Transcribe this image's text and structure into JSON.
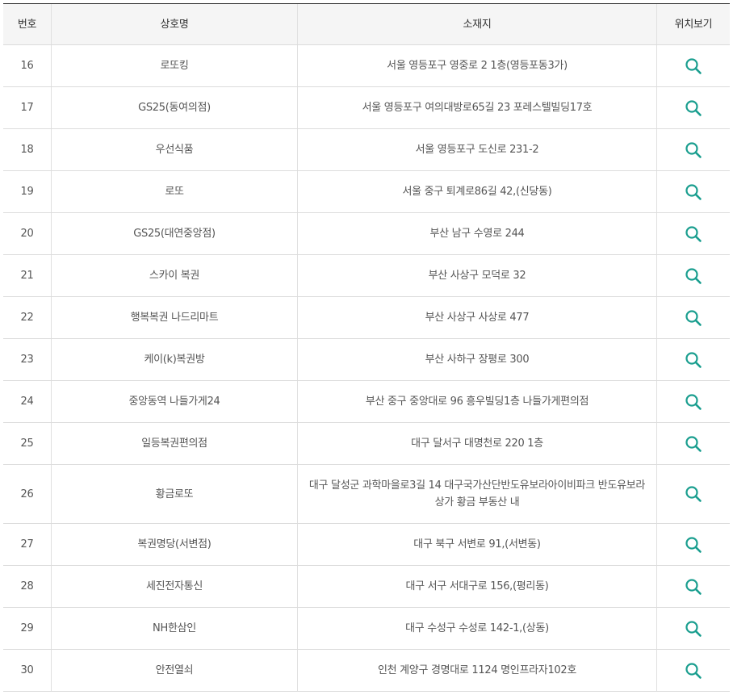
{
  "table": {
    "headers": {
      "number": "번호",
      "store_name": "상호명",
      "address": "소재지",
      "location": "위치보기"
    },
    "rows": [
      {
        "no": "16",
        "name": "로또킹",
        "address": "서울 영등포구 영중로 2 1층(영등포동3가)"
      },
      {
        "no": "17",
        "name": "GS25(동여의점)",
        "address": "서울 영등포구 여의대방로65길 23 포레스텔빌딩17호"
      },
      {
        "no": "18",
        "name": "우선식품",
        "address": "서울 영등포구 도신로 231-2"
      },
      {
        "no": "19",
        "name": "로또",
        "address": "서울 중구 퇴계로86길 42,(신당동)"
      },
      {
        "no": "20",
        "name": "GS25(대연중앙점)",
        "address": "부산 남구 수영로 244"
      },
      {
        "no": "21",
        "name": "스카이 복권",
        "address": "부산 사상구 모덕로 32"
      },
      {
        "no": "22",
        "name": "행복복권 나드리마트",
        "address": "부산 사상구 사상로 477"
      },
      {
        "no": "23",
        "name": "케이(k)복권방",
        "address": "부산 사하구 장평로 300"
      },
      {
        "no": "24",
        "name": "중앙동역 나들가게24",
        "address": "부산 중구 중앙대로 96 흥우빌딩1층 나들가게편의점"
      },
      {
        "no": "25",
        "name": "일등복권편의점",
        "address": "대구 달서구 대명천로 220 1층"
      },
      {
        "no": "26",
        "name": "황금로또",
        "address": "대구 달성군 과학마을로3길 14 대구국가산단반도유보라아이비파크 반도유보라 상가 황금 부동산 내"
      },
      {
        "no": "27",
        "name": "복권명당(서변점)",
        "address": "대구 북구 서변로 91,(서변동)"
      },
      {
        "no": "28",
        "name": "세진전자통신",
        "address": "대구 서구 서대구로 156,(평리동)"
      },
      {
        "no": "29",
        "name": "NH한삼인",
        "address": "대구 수성구 수성로 142-1,(상동)"
      },
      {
        "no": "30",
        "name": "안전열쇠",
        "address": "인천 계양구 경명대로 1124 명인프라자102호"
      }
    ],
    "tall_rows": [
      "26"
    ],
    "icon": "search-icon",
    "icon_color": "#1a9e8f",
    "header_bg": "#f5f5f5",
    "top_border_color": "#333333"
  }
}
